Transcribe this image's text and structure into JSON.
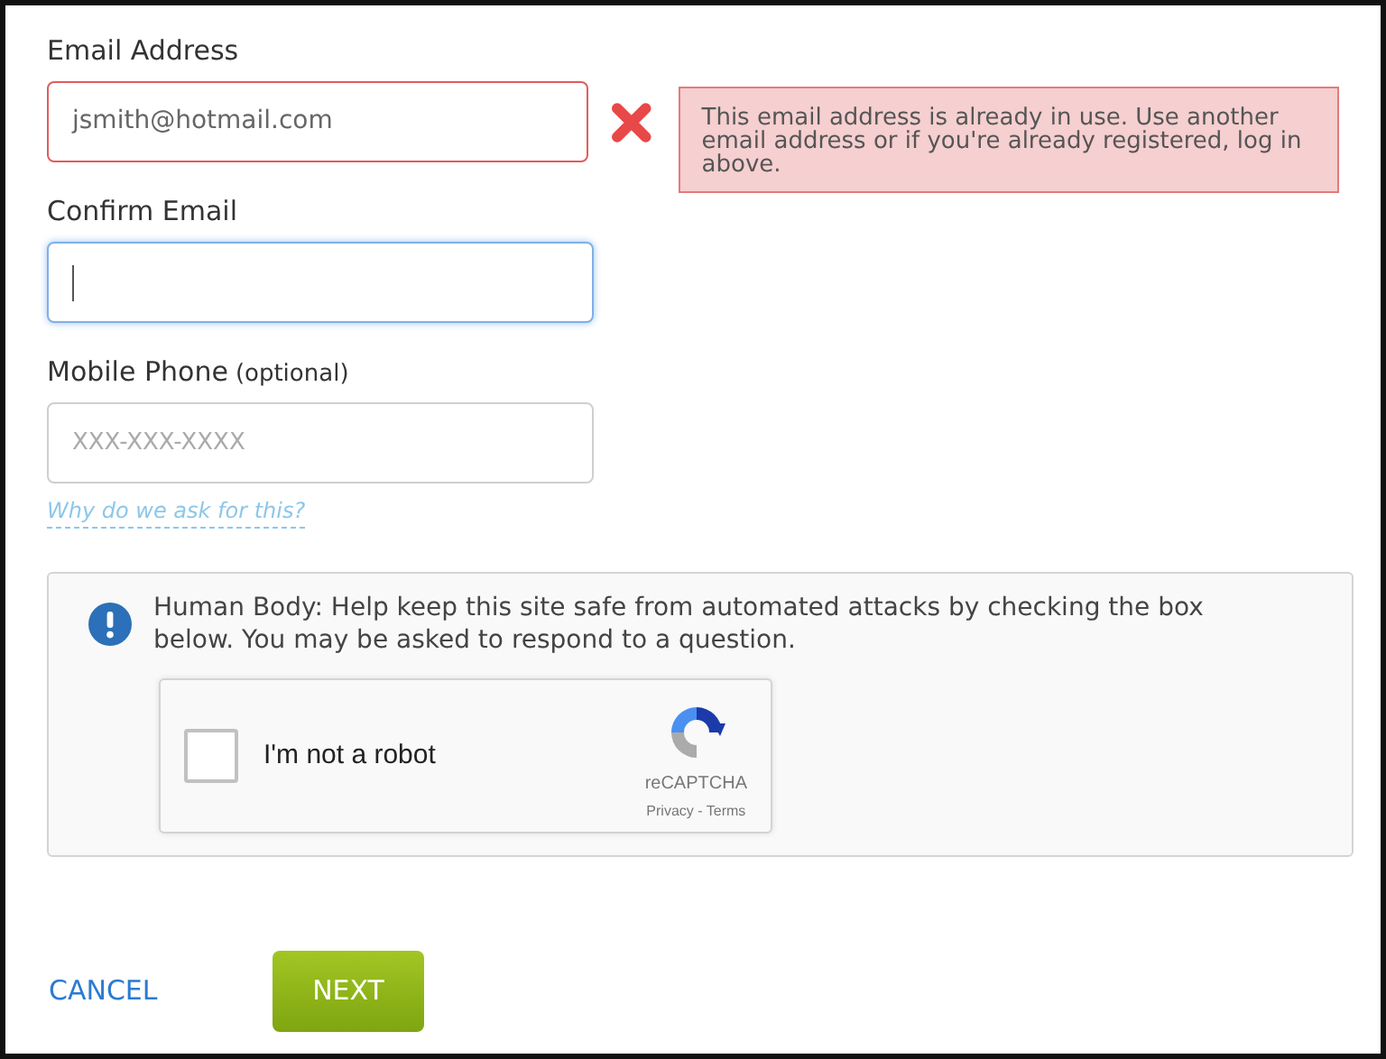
{
  "fields": [
    {
      "label": "Email Address",
      "value": "jsmith@hotmail.com",
      "error": true,
      "focused": false,
      "error_message": "This email address is already in use. Use another email address or if you're already registered, log in above."
    },
    {
      "label": "Confirm Email",
      "error": false,
      "focused": true
    },
    {
      "label": "Mobile Phone",
      "note": "(optional)",
      "placeholder": "XXX-XXX-XXXX",
      "error": false,
      "focused": false,
      "help_link": "Why do we ask for this?"
    }
  ],
  "captcha": {
    "message": "Human Body: Help keep this site safe from automated attacks by checking the box below. You may be asked to respond to a question.",
    "checkbox_label": "I'm not a robot",
    "checked": false,
    "brand": "reCAPTCHA",
    "links": "Privacy - Terms"
  },
  "buttons": {
    "cancel": "CANCEL",
    "next": "NEXT"
  }
}
